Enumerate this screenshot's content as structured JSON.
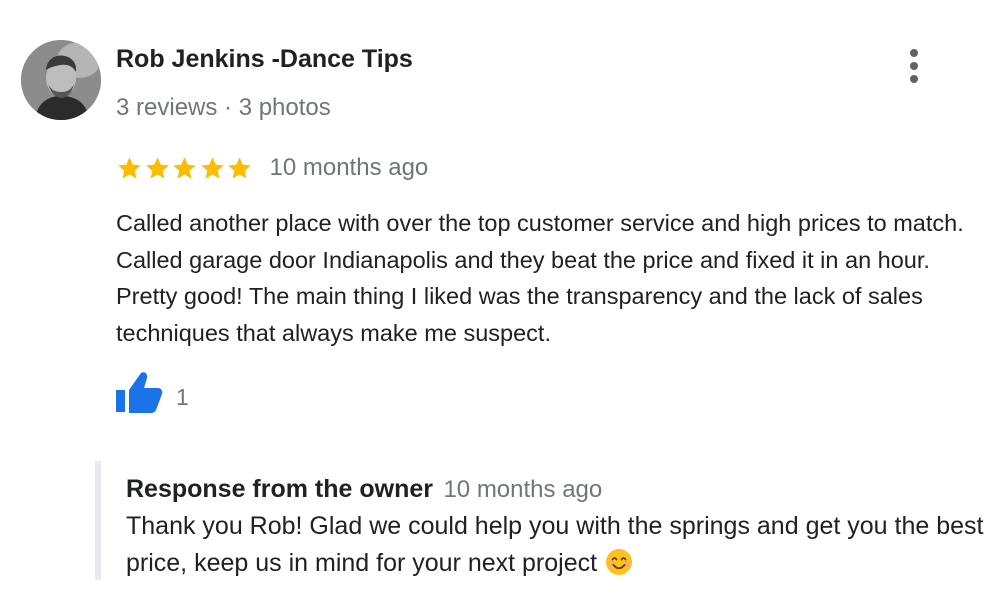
{
  "review": {
    "reviewer": {
      "name": "Rob Jenkins -Dance Tips",
      "meta": "3 reviews · 3 photos"
    },
    "rating": 5,
    "rating_max": 5,
    "date": "10 months ago",
    "text": "Called another place with over the top customer service and high prices to match. Called garage door Indianapolis and they beat the price and fixed it in an hour. Pretty good! The main thing I liked was the transparency and the lack of sales techniques that always make me suspect.",
    "likes": "1"
  },
  "owner_response": {
    "title": "Response from the owner",
    "date": "10 months ago",
    "text": "Thank you Rob! Glad we could help you with the springs and get you the best price, keep us in mind for your next project"
  },
  "icons": {
    "more": "more-vert-icon",
    "star": "star-icon",
    "like": "thumbs-up-icon",
    "emoji": "smiling-face-emoji"
  },
  "colors": {
    "star": "#fbbc04",
    "like": "#1a73e8",
    "secondary_text": "#70757a",
    "primary_text": "#202124",
    "owner_bar": "#e8eaed"
  }
}
